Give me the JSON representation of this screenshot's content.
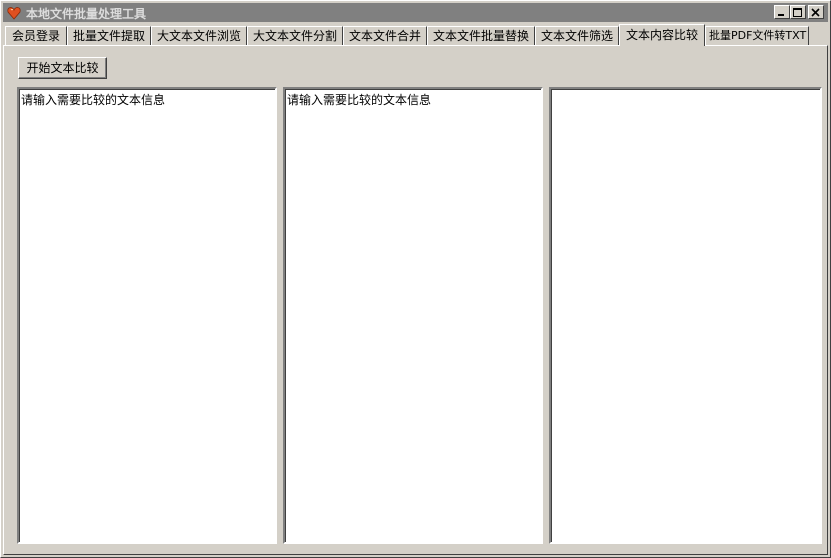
{
  "window": {
    "title": "本地文件批量处理工具",
    "controls": {
      "minimize": "minimize",
      "maximize": "maximize",
      "close": "close"
    }
  },
  "tabs": [
    {
      "label": "会员登录"
    },
    {
      "label": "批量文件提取"
    },
    {
      "label": "大文本文件浏览"
    },
    {
      "label": "大文本文件分割"
    },
    {
      "label": "文本文件合并"
    },
    {
      "label": "文本文件批量替换"
    },
    {
      "label": "文本文件筛选"
    },
    {
      "label": "文本内容比较",
      "active": true
    },
    {
      "label": "批量PDF文件转TXT"
    }
  ],
  "panel": {
    "start_button_label": "开始文本比较",
    "text_a": "请输入需要比较的文本信息",
    "text_b": "请输入需要比较的文本信息",
    "result": ""
  },
  "colors": {
    "face": "#d4d0c8",
    "titlebar_inactive": "#808080",
    "icon": "#e05020"
  }
}
